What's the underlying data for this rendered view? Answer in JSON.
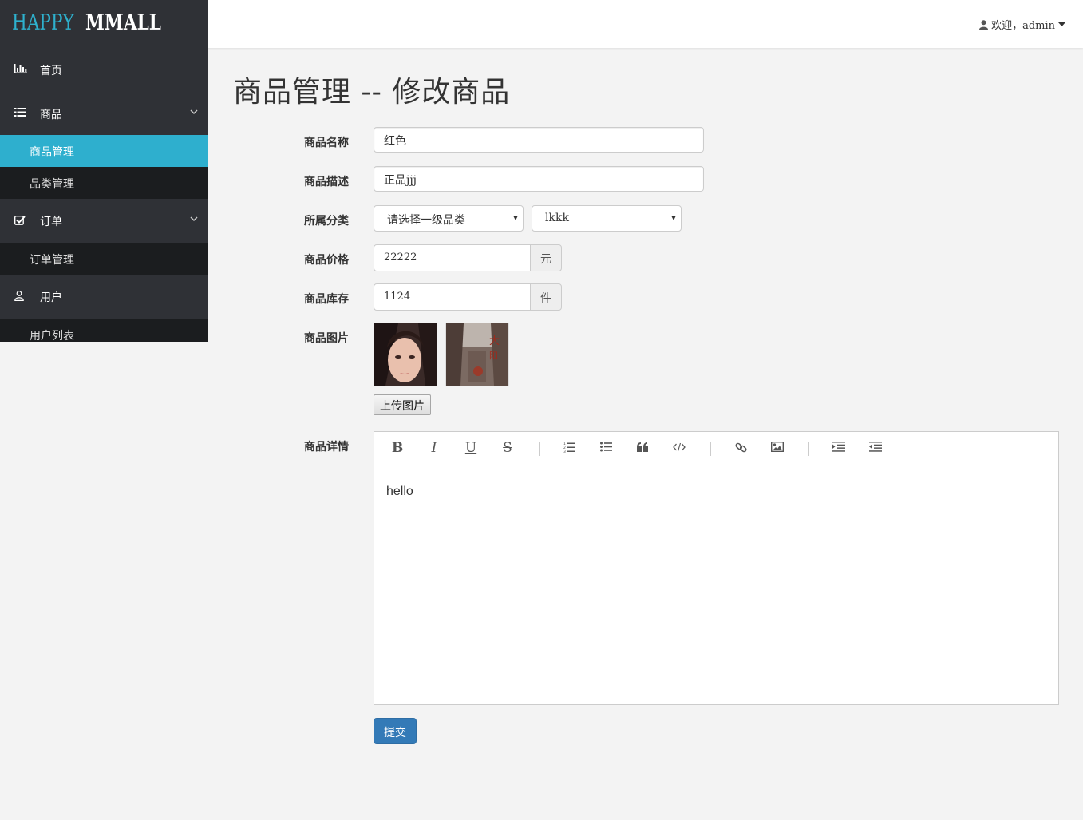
{
  "brand": {
    "part1": "HAPPY",
    "part2": "MMALL"
  },
  "header": {
    "welcome": "欢迎，admin"
  },
  "sidebar": {
    "home": "首页",
    "product": "商品",
    "product_manage": "商品管理",
    "category_manage": "品类管理",
    "order": "订单",
    "order_manage": "订单管理",
    "user": "用户",
    "user_list": "用户列表"
  },
  "page": {
    "title": "商品管理 -- 修改商品"
  },
  "form": {
    "name_label": "商品名称",
    "name_value": "红色",
    "desc_label": "商品描述",
    "desc_value": "正品jjj",
    "category_label": "所属分类",
    "category_first": "请选择一级品类",
    "category_second": "lkkk",
    "price_label": "商品价格",
    "price_value": "22222",
    "price_unit": "元",
    "stock_label": "商品库存",
    "stock_value": "1124",
    "stock_unit": "件",
    "image_label": "商品图片",
    "upload_label": "上传图片",
    "detail_label": "商品详情",
    "detail_content": "hello",
    "submit_label": "提交"
  },
  "editor_toolbar": [
    "bold-icon",
    "italic-icon",
    "underline-icon",
    "strikethrough-icon",
    "ordered-list-icon",
    "unordered-list-icon",
    "blockquote-icon",
    "code-icon",
    "link-icon",
    "image-icon",
    "indent-icon",
    "outdent-icon"
  ],
  "colors": {
    "accent": "#2eafce",
    "sidebar_bg": "#2f3136",
    "sub_bg": "#1b1d1f",
    "primary_btn": "#337ab7"
  }
}
